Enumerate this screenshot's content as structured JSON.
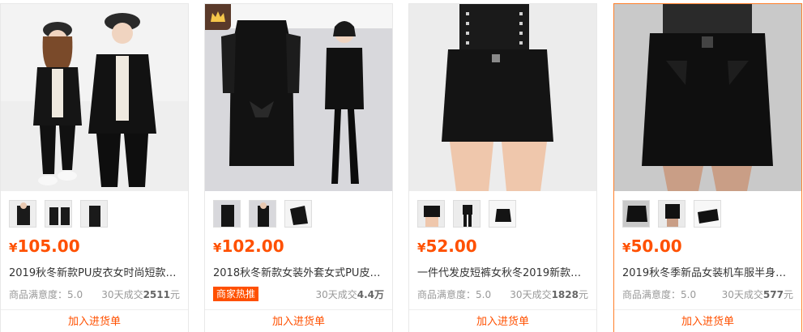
{
  "currency_symbol": "¥",
  "products": [
    {
      "price": "105.00",
      "title": "2019秋冬新款PU皮衣女时尚短款韩版...",
      "satisfaction_label": "商品满意度：5.0",
      "sales_label": "30天成交",
      "sales_value": "2511",
      "sales_unit": "元",
      "hot_tag": "",
      "add_to_cart": "加入进货单"
    },
    {
      "price": "102.00",
      "title": "2018秋冬新款女装外套女式PU皮衣女...",
      "satisfaction_label": "",
      "sales_label": "30天成交",
      "sales_value": "4.4万",
      "sales_unit": "",
      "hot_tag": "商家热推",
      "add_to_cart": "加入进货单"
    },
    {
      "price": "52.00",
      "title": "一件代发皮短裤女秋冬2019新款外穿...",
      "satisfaction_label": "商品满意度：5.0",
      "sales_label": "30天成交",
      "sales_value": "1828",
      "sales_unit": "元",
      "hot_tag": "",
      "add_to_cart": "加入进货单"
    },
    {
      "price": "50.00",
      "title": "2019秋冬季新品女装机车服半身短款...",
      "satisfaction_label": "商品满意度：5.0",
      "sales_label": "30天成交",
      "sales_value": "577",
      "sales_unit": "元",
      "hot_tag": "",
      "add_to_cart": "加入进货单"
    }
  ],
  "colors": {
    "price": "#ff5000",
    "active_border": "#ff7f2a",
    "text": "#333333",
    "muted": "#999999"
  }
}
